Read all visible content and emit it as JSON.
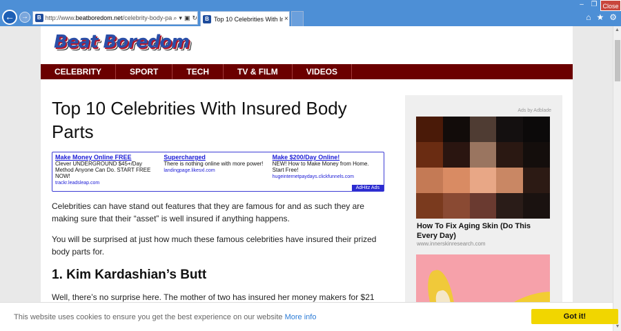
{
  "browser": {
    "window_close_label": "Close",
    "url_prefix": "http://www.",
    "url_domain": "beatboredom.net",
    "url_path": "/celebrity-body-part-",
    "tab_title": "Top 10 Celebrities With Ins...",
    "favicon_letter": "B",
    "icons": [
      "back-icon",
      "forward-icon",
      "search-icon",
      "refresh-icon",
      "close-icon",
      "home-icon",
      "star-icon",
      "gear-icon"
    ]
  },
  "site": {
    "logo": "Beat Boredom",
    "menu": [
      "CELEBRITY",
      "SPORT",
      "TECH",
      "TV & FILM",
      "VIDEOS"
    ],
    "colors": {
      "menu_bg": "#6b0000",
      "logo_blue": "#2a4fa8",
      "logo_red": "#b0182a"
    }
  },
  "article": {
    "title": "Top 10 Celebrities With Insured Body Parts",
    "ads": [
      {
        "headline": "Make Money Online FREE",
        "desc": "Clever UNDERGROUND $45+/Day Method Anyone Can Do. START FREE NOW!",
        "url": "trackr.leadsleap.com"
      },
      {
        "headline": "Supercharged",
        "desc": "There is nothing online with more power!",
        "url": "landingpage.likesxl.com"
      },
      {
        "headline": "Make $200/Day Online!",
        "desc": "NEW! How to Make Money from Home. Start Free!",
        "url": "hugeinternetpaydays.clickfunnels.com"
      }
    ],
    "ad_badge": "AdHitz Ads",
    "para1": "Celebrities can have stand out features that they are famous for and as such they are making sure that their “asset” is well insured if anything happens.",
    "para2": "You will be surprised at just how much these famous celebrities have insured their prized body parts for.",
    "heading1": "1. Kim Kardashian’s Butt",
    "para3": "Well, there’s no surprise here. The mother of two has insured her money makers for $21"
  },
  "sidebar": {
    "ads_by": "Ads by Adblade",
    "ad_headline": "How To Fix Aging Skin (Do This Every Day)",
    "ad_domain": "www.innerskinresearch.com",
    "mosaic_colors": [
      "#4a1a08",
      "#120c0a",
      "#4f3c33",
      "#141010",
      "#0c0a0a",
      "#6a2c12",
      "#2a1510",
      "#9a7560",
      "#2a1812",
      "#140e0c",
      "#c47a55",
      "#d98b63",
      "#e8a786",
      "#c98764",
      "#2c1a14",
      "#7a3a1e",
      "#8a4a33",
      "#6a3a30",
      "#2a1c18",
      "#1a1210"
    ]
  },
  "cookie": {
    "message": "This website uses cookies to ensure you get the best experience on our website",
    "more": "More info",
    "button": "Got it!"
  }
}
